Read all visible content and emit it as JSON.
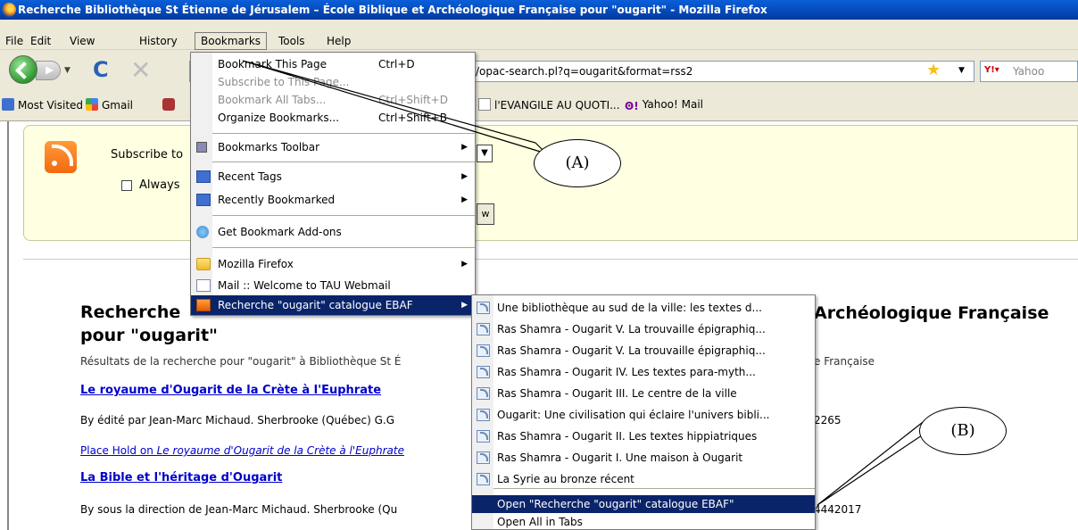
{
  "window": {
    "title": "Recherche Bibliothèque St Étienne de Jérusalem – École Biblique et Archéologique Française pour \"ougarit\" - Mozilla Firefox"
  },
  "menubar": {
    "items": [
      "File",
      "Edit",
      "View",
      "History",
      "Bookmarks",
      "Tools",
      "Help"
    ]
  },
  "navbar": {
    "url": "/opac-search.pl?q=ougarit&format=rss2",
    "search_placeholder": "Yahoo",
    "icons": [
      "back-arrow-icon",
      "forward-arrow-icon",
      "reload-icon",
      "stop-icon",
      "star-icon"
    ]
  },
  "bookmarks_toolbar": {
    "items": [
      "Most Visited",
      "Gmail",
      "l'EVANGILE AU QUOTI...",
      "Yahoo! Mail"
    ]
  },
  "feed": {
    "subscribe_text": "Subscribe to",
    "always_text": "Always",
    "button_fragment": "w",
    "select_arrow": "▼"
  },
  "page": {
    "title_left": "Recherche",
    "title_line2": "pour \"ougarit\"",
    "title_right": "Archéologique Française",
    "intro_left": "Résultats de la recherche pour \"ougarit\" à Bibliothèque St É",
    "intro_right": "e Française",
    "results": [
      {
        "title": "Le royaume d'Ougarit de la Crète à l'Euphrate",
        "by_left": "By édité par Jean-Marc Michaud. Sherbrooke (Québec) G.G",
        "by_right": "2265",
        "hold_prefix": "Place Hold on ",
        "hold_title": "Le royaume d'Ougarit de la Crète à l'Euphrate"
      },
      {
        "title": "La Bible et l'héritage d'Ougarit",
        "by_left": "By sous la direction de Jean-Marc Michaud. Sherbrooke (Qu",
        "by_right": "4442017"
      }
    ]
  },
  "bookmarks_menu": {
    "items": [
      {
        "label": "Bookmark This Page",
        "shortcut": "Ctrl+D",
        "enabled": true
      },
      {
        "label": "Subscribe to This Page...",
        "shortcut": "",
        "enabled": false
      },
      {
        "label": "Bookmark All Tabs...",
        "shortcut": "Ctrl+Shift+D",
        "enabled": false
      },
      {
        "label": "Organize Bookmarks...",
        "shortcut": "Ctrl+Shift+B",
        "enabled": true
      },
      {
        "label": "Bookmarks Toolbar",
        "submenu": true
      },
      {
        "label": "Recent Tags",
        "submenu": true
      },
      {
        "label": "Recently Bookmarked",
        "submenu": true
      },
      {
        "label": "Get Bookmark Add-ons"
      },
      {
        "label": "Mozilla Firefox",
        "submenu": true
      },
      {
        "label": "Mail :: Welcome to TAU Webmail"
      },
      {
        "label": "Recherche \"ougarit\" catalogue EBAF",
        "submenu": true,
        "selected": true
      }
    ]
  },
  "feed_submenu": {
    "items": [
      "Une bibliothèque au sud de la ville: les textes d...",
      "Ras Shamra - Ougarit V. La trouvaille épigraphiq...",
      "Ras Shamra - Ougarit V. La trouvaille épigraphiq...",
      "Ras Shamra - Ougarit IV. Les textes para-myth...",
      "Ras Shamra - Ougarit III. Le centre de la ville",
      "Ougarit: Une civilisation qui éclaire l'univers bibli...",
      "Ras Shamra - Ougarit II. Les textes hippiatriques",
      "Ras Shamra - Ougarit I. Une maison à Ougarit",
      "La Syrie au bronze récent"
    ],
    "open_label": "Open \"Recherche \"ougarit\" catalogue EBAF\"",
    "open_all_label": "Open All in Tabs"
  },
  "annotations": {
    "a": "(A)",
    "b": "(B)"
  },
  "colors": {
    "titlebar": "#0449b9",
    "menu_highlight": "#0a246a",
    "feed_background": "#ffffe1",
    "link": "#0000cc"
  }
}
